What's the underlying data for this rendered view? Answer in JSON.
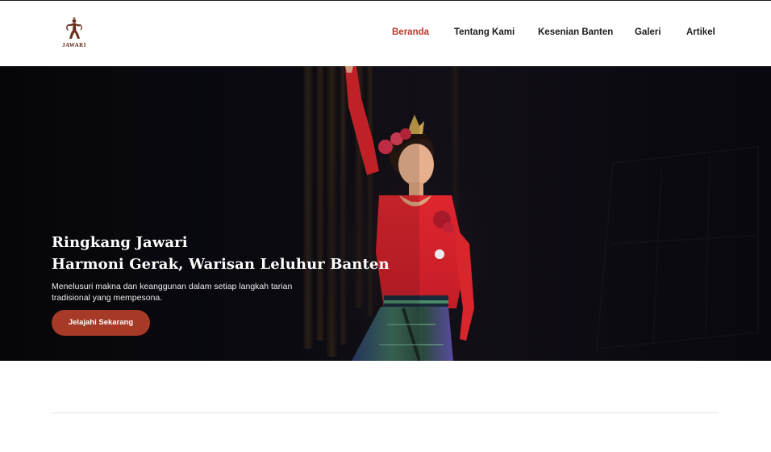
{
  "brand": {
    "logo_text": "JAWARI"
  },
  "nav": {
    "items": [
      {
        "label": "Beranda",
        "active": true
      },
      {
        "label": "Tentang Kami",
        "active": false
      },
      {
        "label": "Kesenian Banten",
        "active": false
      },
      {
        "label": "Galeri",
        "active": false
      },
      {
        "label": "Artikel",
        "active": false
      }
    ]
  },
  "hero": {
    "title_line1": "Ringkang Jawari",
    "title_line2": "Harmoni Gerak, Warisan Leluhur Banten",
    "description": "Menelusuri makna dan keanggunan dalam setiap langkah tarian tradisional yang mempesona.",
    "cta_label": "Jelajahi Sekarang"
  },
  "colors": {
    "accent": "#b5392b",
    "button": "#a63a26",
    "hero_bg": "#07070c"
  }
}
